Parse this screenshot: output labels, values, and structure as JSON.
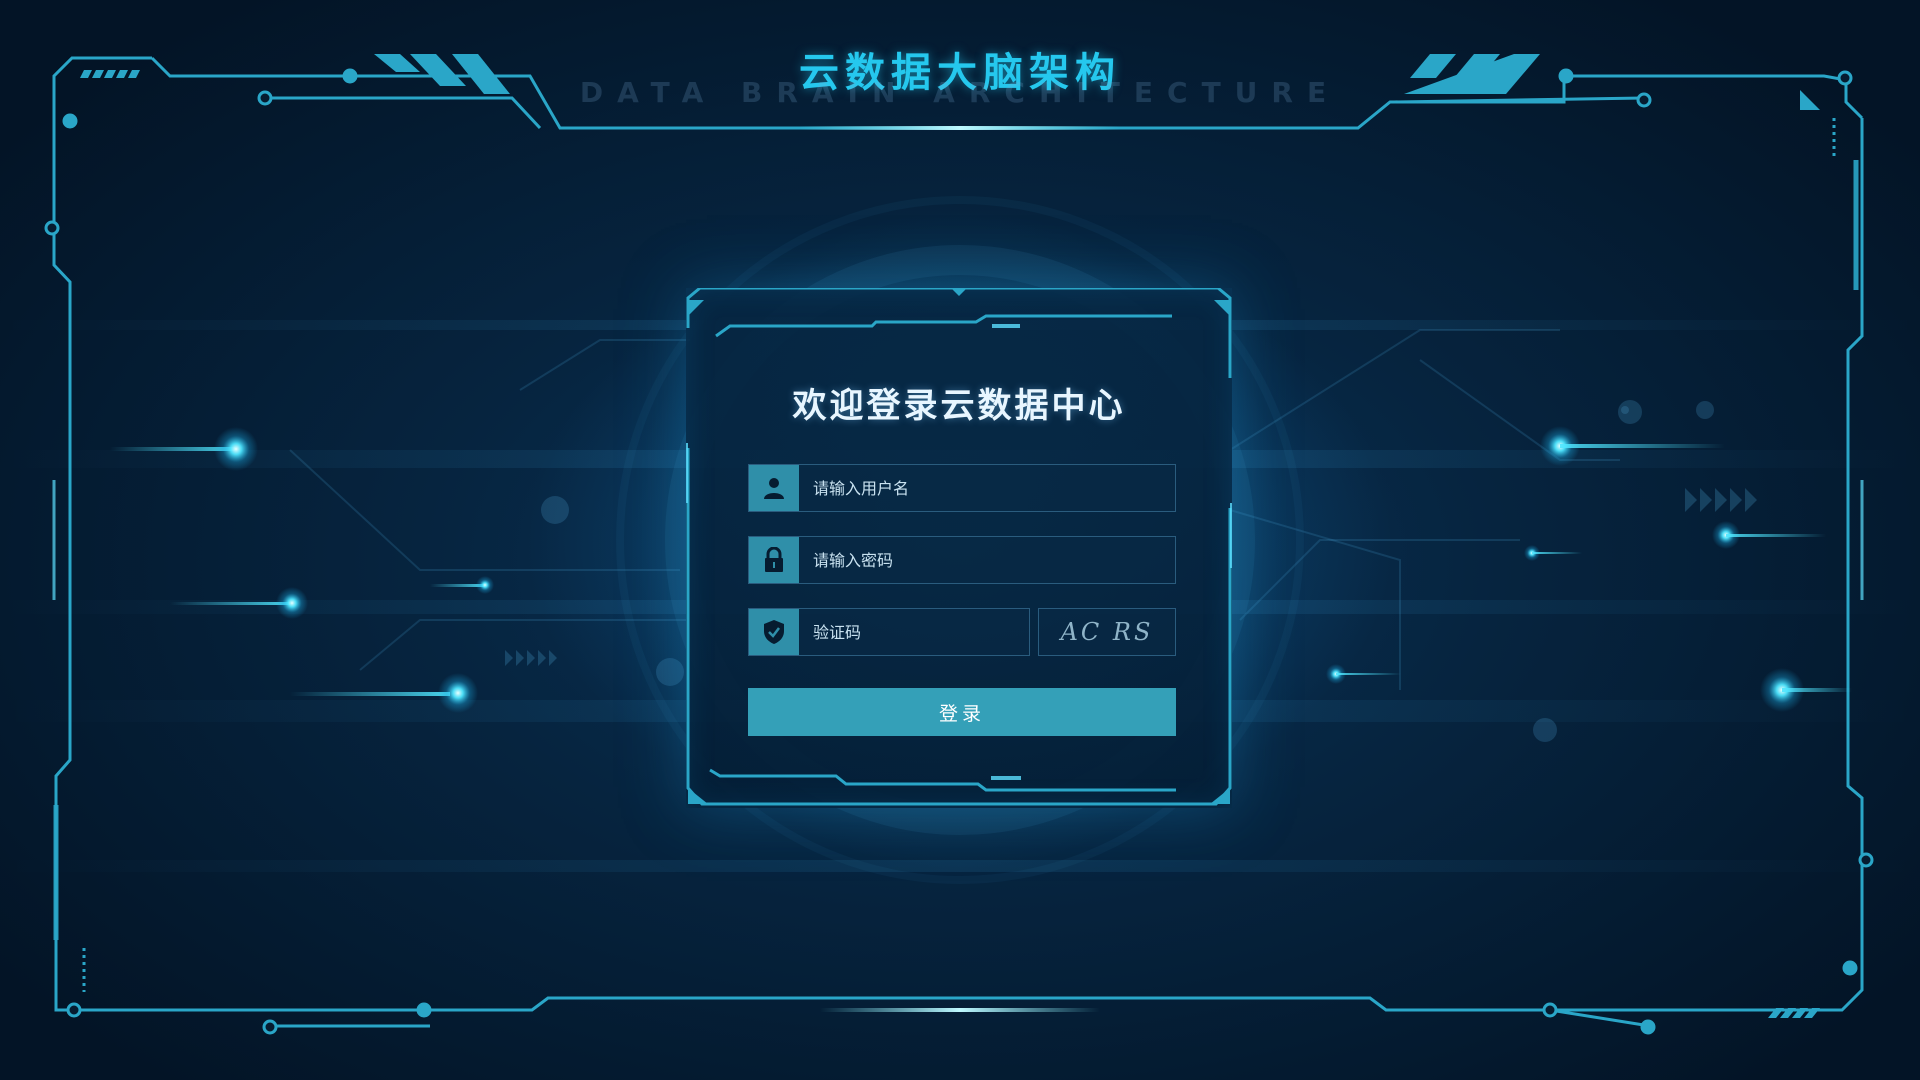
{
  "header": {
    "title": "云数据大脑架构",
    "subtitle": "DATA BRAIN ARCHITECTURE"
  },
  "login": {
    "title": "欢迎登录云数据中心",
    "username_placeholder": "请输入用户名",
    "password_placeholder": "请输入密码",
    "captcha_placeholder": "验证码",
    "captcha_code": "AC RS",
    "submit_label": "登录"
  },
  "icons": {
    "username": "user-icon",
    "password": "lock-icon",
    "captcha": "shield-check-icon"
  },
  "colors": {
    "accent": "#25c8ee",
    "frame": "#2aa6c8",
    "button": "#34a0b8",
    "icon_box": "#2f8fa9",
    "background": "#031426"
  }
}
